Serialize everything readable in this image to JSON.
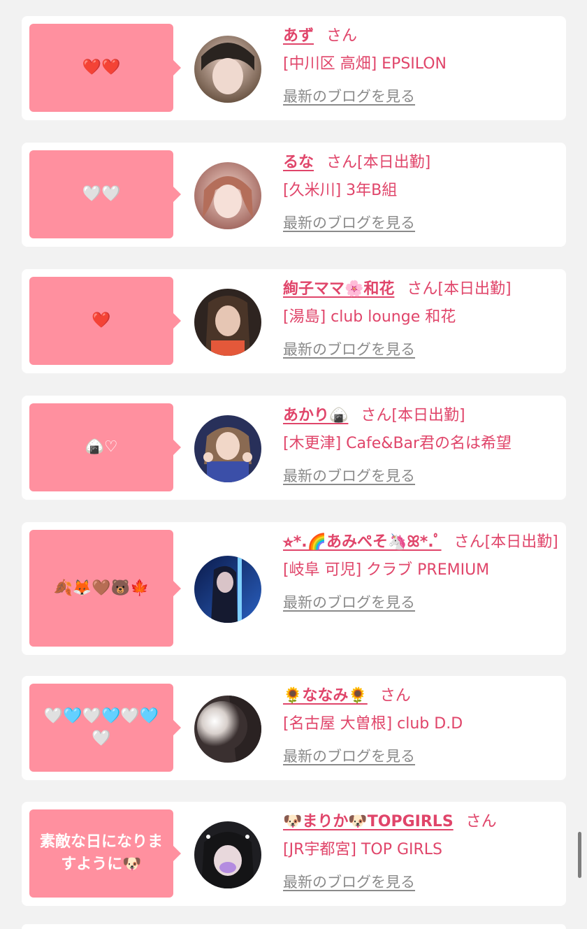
{
  "cards": [
    {
      "bubble": "❤️❤️",
      "name": "あず",
      "suffix": "さん",
      "shop": "[中川区 高畑] EPSILON",
      "blog_link": "最新のブログを見る"
    },
    {
      "bubble": "🤍🤍",
      "name": "るな",
      "suffix": "さん[本日出勤]",
      "shop": "[久米川] 3年B組",
      "blog_link": "最新のブログを見る"
    },
    {
      "bubble": "❤️",
      "name": "絢子ママ🌸和花",
      "suffix": "さん[本日出勤]",
      "shop": "[湯島] club lounge 和花",
      "blog_link": "最新のブログを見る"
    },
    {
      "bubble": "🍙♡",
      "name": "あかり🍙",
      "suffix": "さん[本日出勤]",
      "shop": "[木更津] Cafe&Bar君の名は希望",
      "blog_link": "最新のブログを見る"
    },
    {
      "bubble": "🍂🦊🤎🐻🍁",
      "name": "⭐︎*.🌈あみぺそ🦄ꕤ*.ﾟ",
      "suffix": "さん[本日出勤]",
      "shop": "[岐阜 可児] クラブ PREMIUM",
      "blog_link": "最新のブログを見る"
    },
    {
      "bubble": "🤍🩵🤍🩵🤍🩵🤍",
      "name": "🌻ななみ🌻",
      "suffix": "さん",
      "shop": "[名古屋 大曽根] club D.D",
      "blog_link": "最新のブログを見る"
    },
    {
      "bubble": "素敵な日になりますように🐶",
      "name": "🐶まりか🐶TOPGIRLS",
      "suffix": "さん",
      "shop": "[JR宇都宮] TOP GIRLS",
      "blog_link": "最新のブログを見る"
    }
  ],
  "avatar_colors": [
    "#5a4a3a",
    "#c98f86",
    "#3a2a22",
    "#2b3a6a",
    "#1a2a5a",
    "#cfcfcf",
    "#2a2a2a"
  ]
}
